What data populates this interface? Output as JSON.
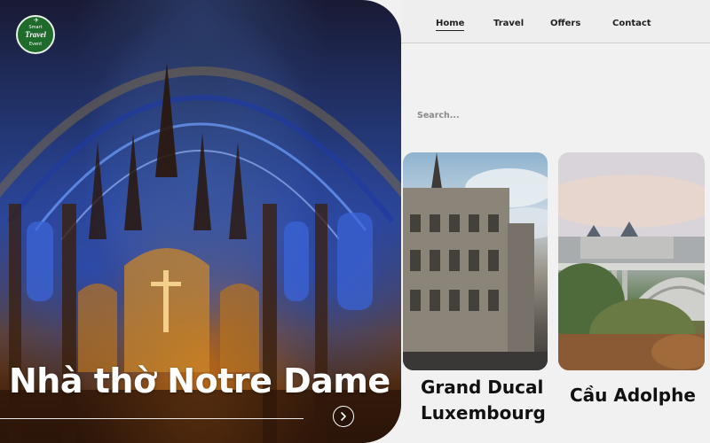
{
  "brand": {
    "logo_line1": "Smart",
    "logo_line2": "Travel",
    "logo_line3": "Event"
  },
  "nav": {
    "items": [
      {
        "label": "Home",
        "active": true
      },
      {
        "label": "Travel",
        "active": false
      },
      {
        "label": "Offers",
        "active": false
      },
      {
        "label": "Contact",
        "active": false
      }
    ]
  },
  "search": {
    "placeholder": "Search..."
  },
  "hero": {
    "title": "Nhà thờ Notre Dame",
    "next_icon": "chevron-right-icon"
  },
  "cards": [
    {
      "title": "Grand Ducal Luxembourg"
    },
    {
      "title": "Cầu Adolphe"
    }
  ],
  "colors": {
    "logo_green": "#1e6b2c",
    "nav_bg": "#eeeeee",
    "text_dark": "#111111"
  }
}
